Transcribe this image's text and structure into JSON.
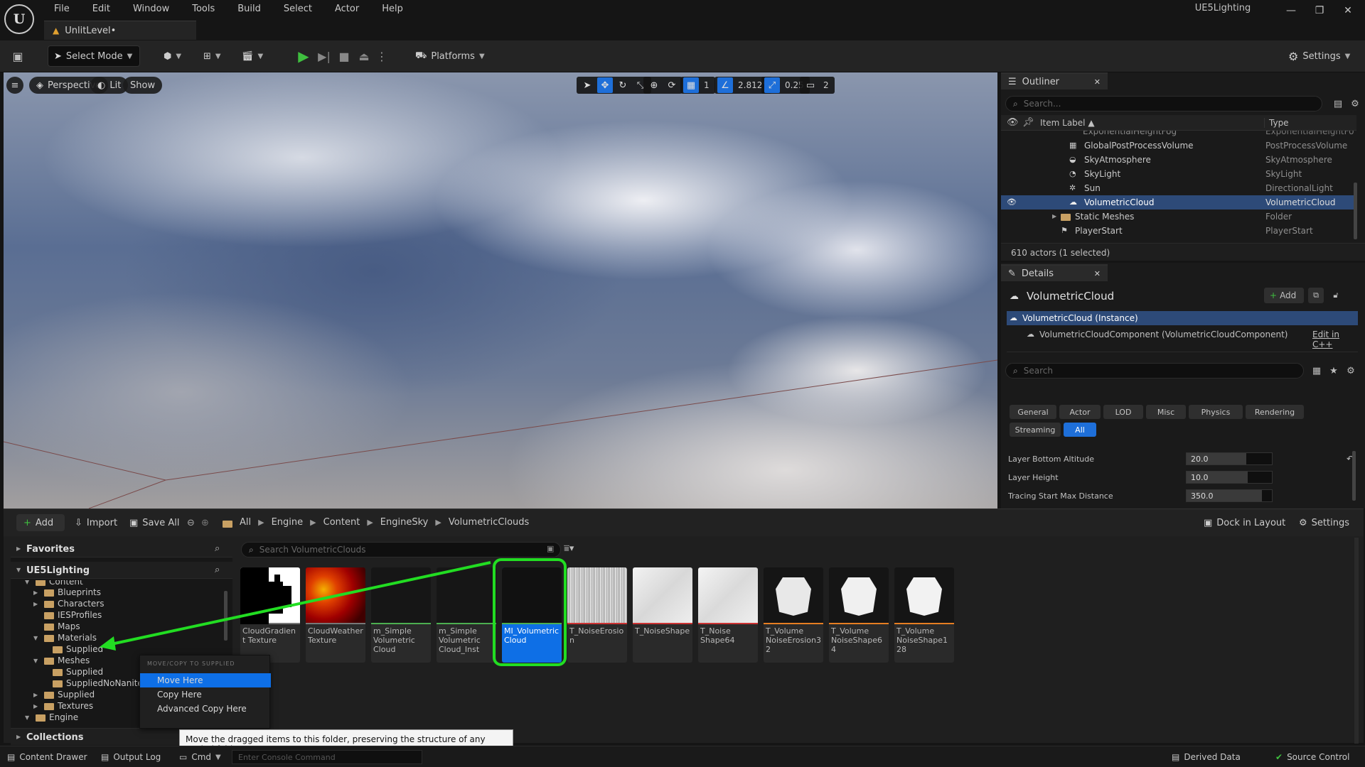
{
  "window": {
    "project_name": "UE5Lighting",
    "level_tab": "UnlitLevel•"
  },
  "menu": [
    "File",
    "Edit",
    "Window",
    "Tools",
    "Build",
    "Select",
    "Actor",
    "Help"
  ],
  "toolbar": {
    "select_mode": "Select Mode",
    "platforms": "Platforms",
    "settings": "Settings"
  },
  "viewport": {
    "perspective": "Perspective",
    "lit": "Lit",
    "show": "Show",
    "grid_snap": "1",
    "angle_snap": "2.812°",
    "scale_snap": "0.25",
    "camera_speed": "2"
  },
  "outliner": {
    "tab": "Outliner",
    "search_placeholder": "Search...",
    "col_label": "Item Label ▲",
    "col_type": "Type",
    "rows": [
      {
        "label": "ExponentialHeightFog",
        "type": "ExponentialHeightFo"
      },
      {
        "label": "GlobalPostProcessVolume",
        "type": "PostProcessVolume"
      },
      {
        "label": "SkyAtmosphere",
        "type": "SkyAtmosphere"
      },
      {
        "label": "SkyLight",
        "type": "SkyLight"
      },
      {
        "label": "Sun",
        "type": "DirectionalLight"
      },
      {
        "label": "VolumetricCloud",
        "type": "VolumetricCloud"
      },
      {
        "label": "Static Meshes",
        "type": "Folder"
      },
      {
        "label": "PlayerStart",
        "type": "PlayerStart"
      }
    ],
    "status": "610 actors (1 selected)"
  },
  "details": {
    "tab": "Details",
    "actor_name": "VolumetricCloud",
    "add_label": "Add",
    "instance_label": "VolumetricCloud (Instance)",
    "component_label": "VolumetricCloudComponent (VolumetricCloudComponent)",
    "edit_cpp": "Edit in C++",
    "search_placeholder": "Search",
    "categories": [
      "General",
      "Actor",
      "LOD",
      "Misc",
      "Physics",
      "Rendering"
    ],
    "categories2": [
      "Streaming",
      "All"
    ],
    "properties": [
      {
        "name": "Layer Bottom Altitude",
        "value": "20.0",
        "fill": 0.7
      },
      {
        "name": "Layer Height",
        "value": "10.0",
        "fill": 0.72
      },
      {
        "name": "Tracing Start Max Distance",
        "value": "350.0",
        "fill": 0.88
      }
    ]
  },
  "content_browser": {
    "add": "Add",
    "import": "Import",
    "save_all": "Save All",
    "breadcrumb": [
      "All",
      "Engine",
      "Content",
      "EngineSky",
      "VolumetricClouds"
    ],
    "dock_in_layout": "Dock in Layout",
    "settings": "Settings",
    "favorites": "Favorites",
    "project": "UE5Lighting",
    "search_placeholder": "Search VolumetricClouds",
    "tree": [
      {
        "label": "Content",
        "indent": 1
      },
      {
        "label": "Blueprints",
        "indent": 2
      },
      {
        "label": "Characters",
        "indent": 2
      },
      {
        "label": "IESProfiles",
        "indent": 2
      },
      {
        "label": "Maps",
        "indent": 2
      },
      {
        "label": "Materials",
        "indent": 2
      },
      {
        "label": "Supplied",
        "indent": 3
      },
      {
        "label": "Meshes",
        "indent": 2
      },
      {
        "label": "Supplied",
        "indent": 3
      },
      {
        "label": "SuppliedNoNanite",
        "indent": 3
      },
      {
        "label": "Supplied",
        "indent": 2
      },
      {
        "label": "Textures",
        "indent": 2
      },
      {
        "label": "Engine",
        "indent": 1
      }
    ],
    "collections": "Collections",
    "assets": [
      {
        "label": "CloudGradient Texture",
        "kind": "gradient"
      },
      {
        "label": "CloudWeather Texture",
        "kind": "weather"
      },
      {
        "label": "m_Simple Volumetric Cloud",
        "kind": "dark"
      },
      {
        "label": "m_Simple Volumetric Cloud_Inst",
        "kind": "dark"
      },
      {
        "label": "MI_Volumetric Cloud",
        "kind": "selected"
      },
      {
        "label": "T_NoiseErosion",
        "kind": "noise"
      },
      {
        "label": "T_NoiseShape",
        "kind": "white"
      },
      {
        "label": "T_Noise Shape64",
        "kind": "white"
      },
      {
        "label": "T_Volume NoiseErosion32",
        "kind": "hex"
      },
      {
        "label": "T_Volume NoiseShape64",
        "kind": "hex"
      },
      {
        "label": "T_Volume NoiseShape128",
        "kind": "hex"
      }
    ]
  },
  "context_menu": {
    "header": "MOVE/COPY TO SUPPLIED",
    "items": [
      "Move Here",
      "Copy Here",
      "Advanced Copy Here"
    ],
    "tooltip": "Move the dragged items to this folder, preserving the structure of any copied folders."
  },
  "statusbar": {
    "content_drawer": "Content Drawer",
    "output_log": "Output Log",
    "cmd": "Cmd",
    "console_placeholder": "Enter Console Command",
    "derived_data": "Derived Data",
    "source_control": "Source Control"
  }
}
